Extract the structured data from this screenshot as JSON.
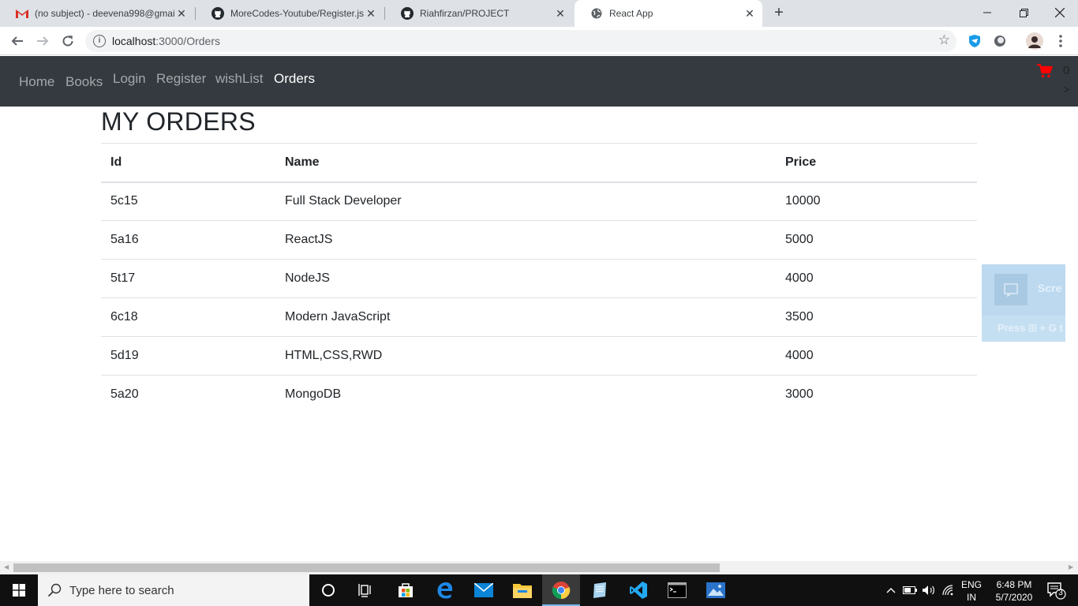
{
  "browser": {
    "tabs": [
      {
        "title": "(no subject) - deevena998@gmail",
        "icon": "gmail-icon",
        "active": false
      },
      {
        "title": "MoreCodes-Youtube/Register.js at",
        "icon": "github-icon",
        "active": false
      },
      {
        "title": "Riahfirzan/PROJECT",
        "icon": "github-icon",
        "active": false
      },
      {
        "title": "React App",
        "icon": "globe-icon",
        "active": true
      }
    ],
    "url_host": "localhost",
    "url_path": ":3000/Orders"
  },
  "navbar": {
    "links": [
      {
        "label": "Home",
        "active": false
      },
      {
        "label": "Books",
        "active": false
      },
      {
        "label": "Login",
        "active": false
      },
      {
        "label": "Register",
        "active": false
      },
      {
        "label": "wishList",
        "active": false
      },
      {
        "label": "Orders",
        "active": true
      }
    ],
    "cart_count": "0",
    "cart_arrow": ">",
    "cart_color": "#ff0000"
  },
  "page": {
    "title": "MY ORDERS",
    "columns": [
      "Id",
      "Name",
      "Price"
    ],
    "rows": [
      {
        "id": "5c15",
        "name": "Full Stack Developer",
        "price": "10000"
      },
      {
        "id": "5a16",
        "name": "ReactJS",
        "price": "5000"
      },
      {
        "id": "5t17",
        "name": "NodeJS",
        "price": "4000"
      },
      {
        "id": "6c18",
        "name": "Modern JavaScript",
        "price": "3500"
      },
      {
        "id": "5d19",
        "name": "HTML,CSS,RWD",
        "price": "4000"
      },
      {
        "id": "5a20",
        "name": "MongoDB",
        "price": "3000"
      }
    ]
  },
  "snip_overlay": {
    "title": "Scre",
    "hint": "Press ⊞ + G t"
  },
  "taskbar": {
    "search_placeholder": "Type here to search",
    "language_line1": "ENG",
    "language_line2": "IN",
    "time": "6:48 PM",
    "date": "5/7/2020",
    "notification_count": "3"
  }
}
